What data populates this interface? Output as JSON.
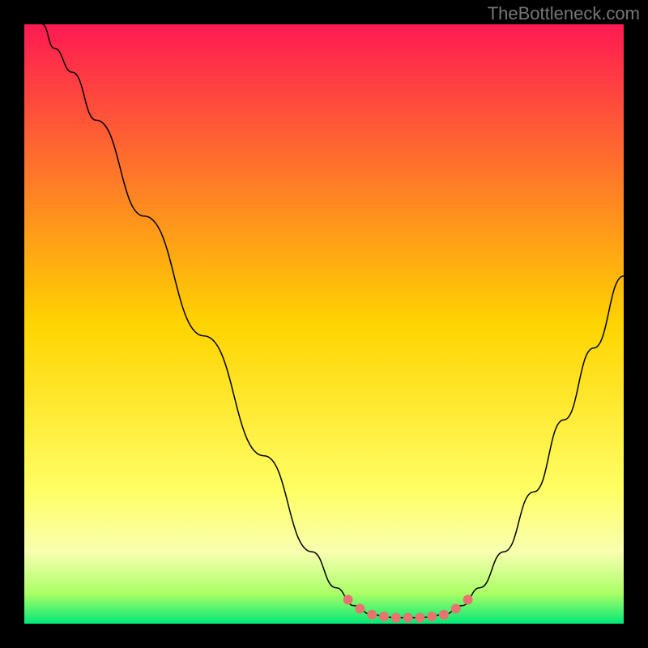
{
  "watermark": "TheBottleneck.com",
  "chart_data": {
    "type": "line",
    "title": "",
    "xlabel": "",
    "ylabel": "",
    "xlim": [
      0,
      100
    ],
    "ylim": [
      0,
      100
    ],
    "background": {
      "type": "vertical-gradient",
      "stops": [
        {
          "offset": 0,
          "color": "#ff1a52"
        },
        {
          "offset": 50,
          "color": "#ffd400"
        },
        {
          "offset": 78,
          "color": "#ffff66"
        },
        {
          "offset": 88,
          "color": "#f8ffb0"
        },
        {
          "offset": 95,
          "color": "#aaff66"
        },
        {
          "offset": 100,
          "color": "#00e878"
        }
      ]
    },
    "series": [
      {
        "name": "bottleneck-curve",
        "color": "#000000",
        "width": 1.5,
        "points": [
          {
            "x": 3,
            "y": 100
          },
          {
            "x": 5,
            "y": 96
          },
          {
            "x": 8,
            "y": 92
          },
          {
            "x": 12,
            "y": 84
          },
          {
            "x": 20,
            "y": 68
          },
          {
            "x": 30,
            "y": 48
          },
          {
            "x": 40,
            "y": 28
          },
          {
            "x": 48,
            "y": 12
          },
          {
            "x": 52,
            "y": 6
          },
          {
            "x": 55,
            "y": 3
          },
          {
            "x": 58,
            "y": 1.5
          },
          {
            "x": 62,
            "y": 1
          },
          {
            "x": 66,
            "y": 1
          },
          {
            "x": 70,
            "y": 1.5
          },
          {
            "x": 73,
            "y": 3
          },
          {
            "x": 76,
            "y": 6
          },
          {
            "x": 80,
            "y": 12
          },
          {
            "x": 85,
            "y": 22
          },
          {
            "x": 90,
            "y": 34
          },
          {
            "x": 95,
            "y": 46
          },
          {
            "x": 100,
            "y": 58
          }
        ]
      },
      {
        "name": "highlight-markers",
        "color": "#e8736f",
        "marker_radius": 6,
        "points": [
          {
            "x": 54,
            "y": 4
          },
          {
            "x": 56,
            "y": 2.5
          },
          {
            "x": 58,
            "y": 1.5
          },
          {
            "x": 60,
            "y": 1.2
          },
          {
            "x": 62,
            "y": 1
          },
          {
            "x": 64,
            "y": 1
          },
          {
            "x": 66,
            "y": 1
          },
          {
            "x": 68,
            "y": 1.2
          },
          {
            "x": 70,
            "y": 1.5
          },
          {
            "x": 72,
            "y": 2.5
          },
          {
            "x": 74,
            "y": 4
          }
        ]
      }
    ]
  }
}
